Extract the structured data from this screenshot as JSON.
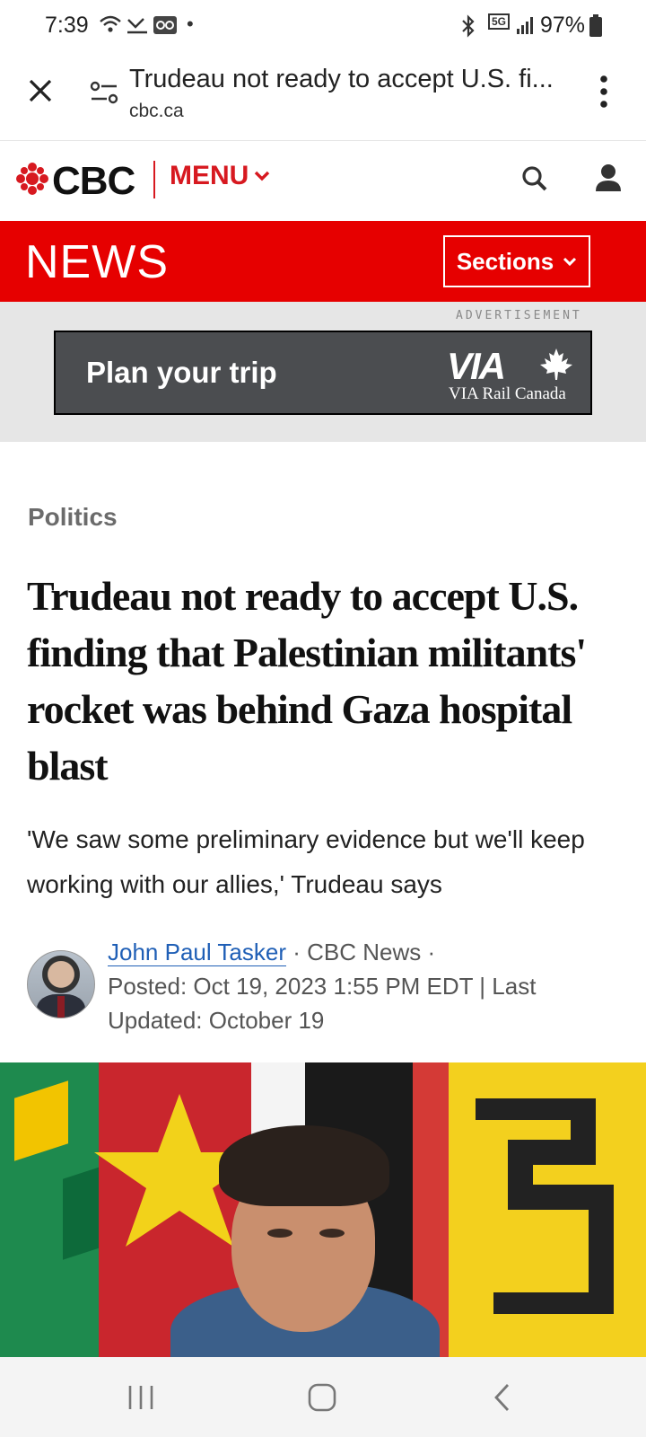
{
  "status_bar": {
    "time": "7:39",
    "network": "5G",
    "battery": "97%"
  },
  "custom_tab": {
    "title": "Trudeau not ready to accept U.S. fi...",
    "url": "cbc.ca"
  },
  "header": {
    "logo_text": "CBC",
    "menu_label": "MENU"
  },
  "news_bar": {
    "title": "NEWS",
    "sections_label": "Sections"
  },
  "ad": {
    "label": "ADVERTISEMENT",
    "text": "Plan your trip",
    "logo_mark": "VIA",
    "logo_text": "VIA Rail Canada"
  },
  "article": {
    "category": "Politics",
    "headline": "Trudeau not ready to accept U.S. finding that Palestinian militants' rocket was behind Gaza hospital blast",
    "deck": "'We saw some preliminary evidence but we'll keep working with our allies,' Trudeau says",
    "author": "John Paul Tasker",
    "source": " · CBC News · ",
    "posted": "Posted: Oct 19, 2023 1:55 PM EDT | Last Updated: October 19"
  },
  "colors": {
    "cbc_red": "#e60000",
    "menu_red": "#d71920",
    "link_blue": "#1f5fb6"
  },
  "icons": [
    "close-icon",
    "site-settings-icon",
    "more-options-icon",
    "search-icon",
    "account-icon",
    "chevron-down-icon",
    "cbc-gem-icon",
    "maple-leaf-icon",
    "recent-apps-icon",
    "home-icon",
    "back-icon"
  ]
}
